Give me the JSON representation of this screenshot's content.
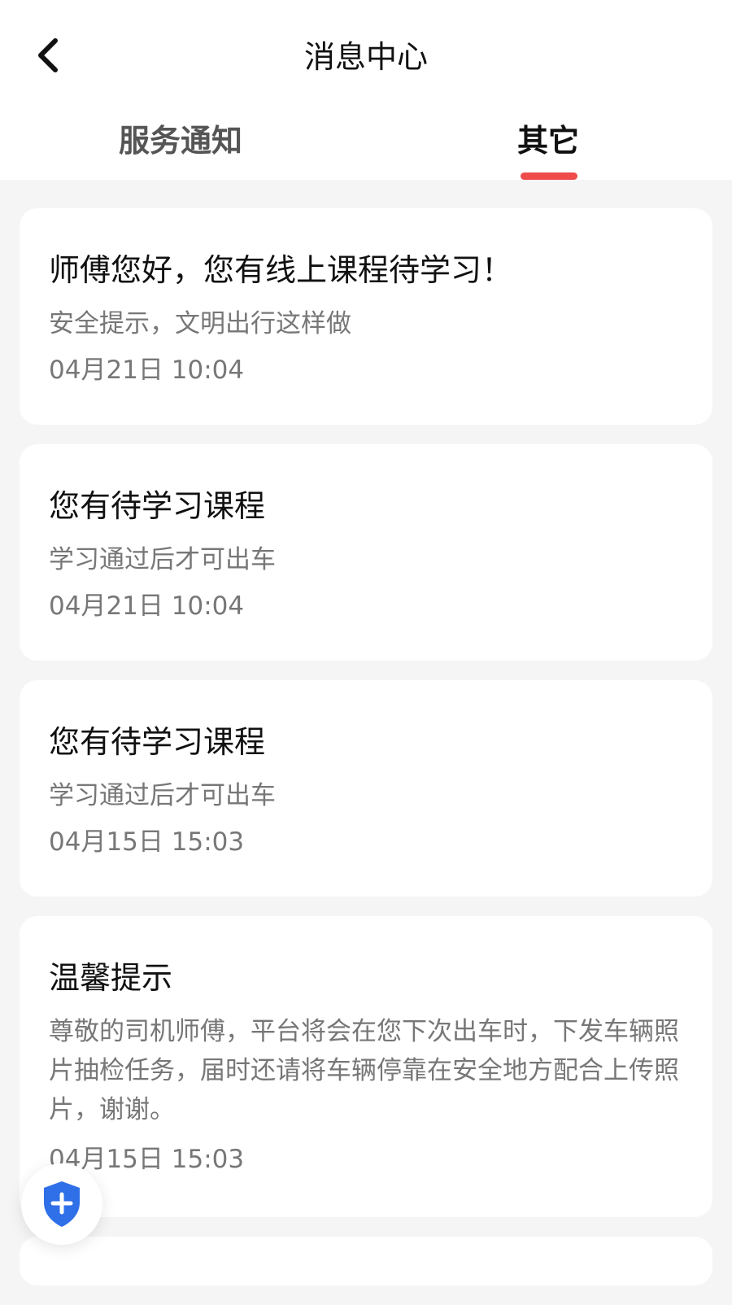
{
  "header": {
    "title": "消息中心",
    "back_icon": "chevron-left-icon"
  },
  "tabs": [
    {
      "label": "服务通知",
      "active": false
    },
    {
      "label": "其它",
      "active": true
    }
  ],
  "colors": {
    "accent": "#f04b4b",
    "background": "#f5f5f5",
    "card": "#ffffff",
    "secondary_text": "#777777",
    "shield": "#2f6fe8"
  },
  "messages": [
    {
      "title": "师傅您好，您有线上课程待学习！",
      "desc": "安全提示，文明出行这样做",
      "time": "04月21日 10:04"
    },
    {
      "title": "您有待学习课程",
      "desc": "学习通过后才可出车",
      "time": "04月21日 10:04"
    },
    {
      "title": "您有待学习课程",
      "desc": "学习通过后才可出车",
      "time": "04月15日 15:03"
    },
    {
      "title": "温馨提示",
      "desc": "尊敬的司机师傅，平台将会在您下次出车时，下发车辆照片抽检任务，届时还请将车辆停靠在安全地方配合上传照片，谢谢。",
      "time": "04月15日 15:03"
    }
  ],
  "floating_button": {
    "icon": "shield-plus-icon"
  }
}
